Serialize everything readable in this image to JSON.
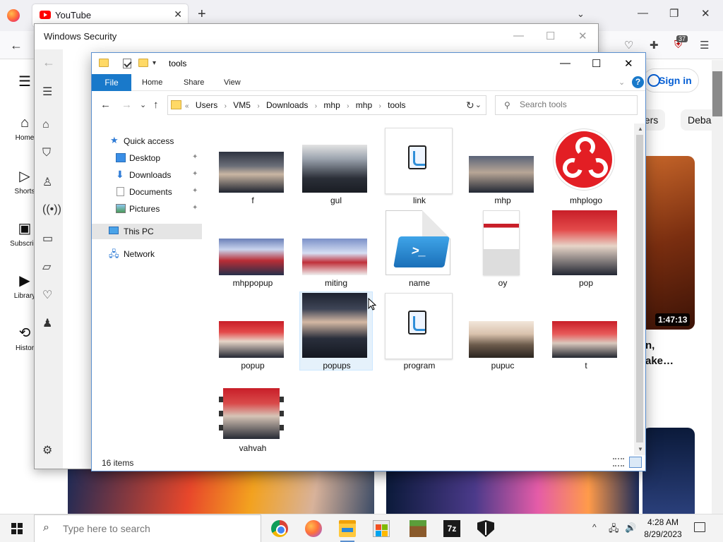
{
  "browser": {
    "tab_title": "YouTube",
    "tab_close": "✕",
    "new_tab": "+",
    "list_tabs": "⌄",
    "win_min": "—",
    "win_max": "❐",
    "win_close": "✕",
    "back": "←",
    "extension_badge": "37",
    "menu": "☰"
  },
  "youtube": {
    "menu_icon": "☰",
    "nav": [
      {
        "label": "Home",
        "icon": "home-icon"
      },
      {
        "label": "Shorts",
        "icon": "shorts-icon"
      },
      {
        "label": "Subscript",
        "icon": "subscriptions-icon"
      },
      {
        "label": "Library",
        "icon": "library-icon"
      },
      {
        "label": "Histor",
        "icon": "history-icon"
      }
    ],
    "sign_in": "Sign in",
    "chips": [
      "gers",
      "Deba"
    ],
    "video_duration": "1:47:13",
    "video_title_line1": "n,",
    "video_title_line2": "ake…"
  },
  "windows_security": {
    "title": "Windows Security",
    "back": "←",
    "min": "—",
    "max": "☐",
    "close": "✕"
  },
  "explorer": {
    "title": "tools",
    "min": "—",
    "max": "☐",
    "close": "✕",
    "ribbon": {
      "file": "File",
      "home": "Home",
      "share": "Share",
      "view": "View",
      "expand": "⌄",
      "help": "?"
    },
    "nav_back": "←",
    "nav_forward": "→",
    "nav_recent": "⌄",
    "nav_up": "↑",
    "address": {
      "overflow": "«",
      "crumbs": [
        "Users",
        "VM5",
        "Downloads",
        "mhp",
        "mhp",
        "tools"
      ],
      "separator": "›",
      "dropdown": "⌄",
      "refresh": "↻"
    },
    "search": {
      "placeholder": "Search tools"
    },
    "nav_pane": [
      {
        "label": "Quick access",
        "pinned": false
      },
      {
        "label": "Desktop",
        "pinned": true
      },
      {
        "label": "Downloads",
        "pinned": true
      },
      {
        "label": "Documents",
        "pinned": true
      },
      {
        "label": "Pictures",
        "pinned": true
      },
      {
        "label": "This PC",
        "pinned": false
      },
      {
        "label": "Network",
        "pinned": false
      }
    ],
    "pin_icon": "📌",
    "files": [
      "f",
      "gul",
      "link",
      "mhp",
      "mhplogo",
      "mhppopup",
      "miting",
      "name",
      "oy",
      "pop",
      "popup",
      "popups",
      "program",
      "pupuc",
      "t",
      "vahvah"
    ],
    "selected": "popups",
    "status": "16 items",
    "ps_glyph": ">_",
    "scroll_up": "▲",
    "scroll_down": "▼"
  },
  "taskbar": {
    "search_placeholder": "Type here to search",
    "search_icon": "⌕",
    "zip_label": "7z",
    "tray_chevron": "^",
    "tray_network": "🖧",
    "tray_volume": "🔊",
    "time": "4:28 AM",
    "date": "8/29/2023"
  }
}
